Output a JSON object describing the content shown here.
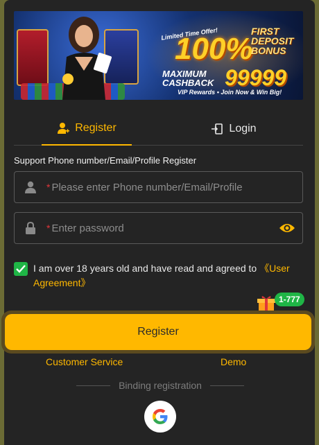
{
  "banner": {
    "limited": "Limited Time Offer!",
    "percent": "100%",
    "first_deposit": "FIRST DEPOSIT BONUS",
    "maximum": "MAXIMUM CASHBACK",
    "amount": "99999",
    "vip": "VIP Rewards • Join Now & Win Big!"
  },
  "tabs": {
    "register": "Register",
    "login": "Login"
  },
  "support_text": "Support Phone number/Email/Profile Register",
  "fields": {
    "account": {
      "required_mark": "*",
      "placeholder": "Please enter Phone number/Email/Profile",
      "value": ""
    },
    "password": {
      "required_mark": "*",
      "placeholder": "Enter password",
      "value": ""
    }
  },
  "agreement": {
    "checked": true,
    "text": "I am over 18 years old and have read and agreed to ",
    "link": "《User Agreement》"
  },
  "promo_badge": "1-777",
  "register_button": "Register",
  "links": {
    "customer_service": "Customer Service",
    "demo": "Demo"
  },
  "binding_label": "Binding registration",
  "colors": {
    "accent": "#ffb800",
    "background": "#242424",
    "check": "#1fb546",
    "required": "#e0353a"
  },
  "icons": [
    "user-icon",
    "lock-icon",
    "eye-icon",
    "login-icon",
    "check-icon",
    "gift-icon",
    "google-icon"
  ]
}
